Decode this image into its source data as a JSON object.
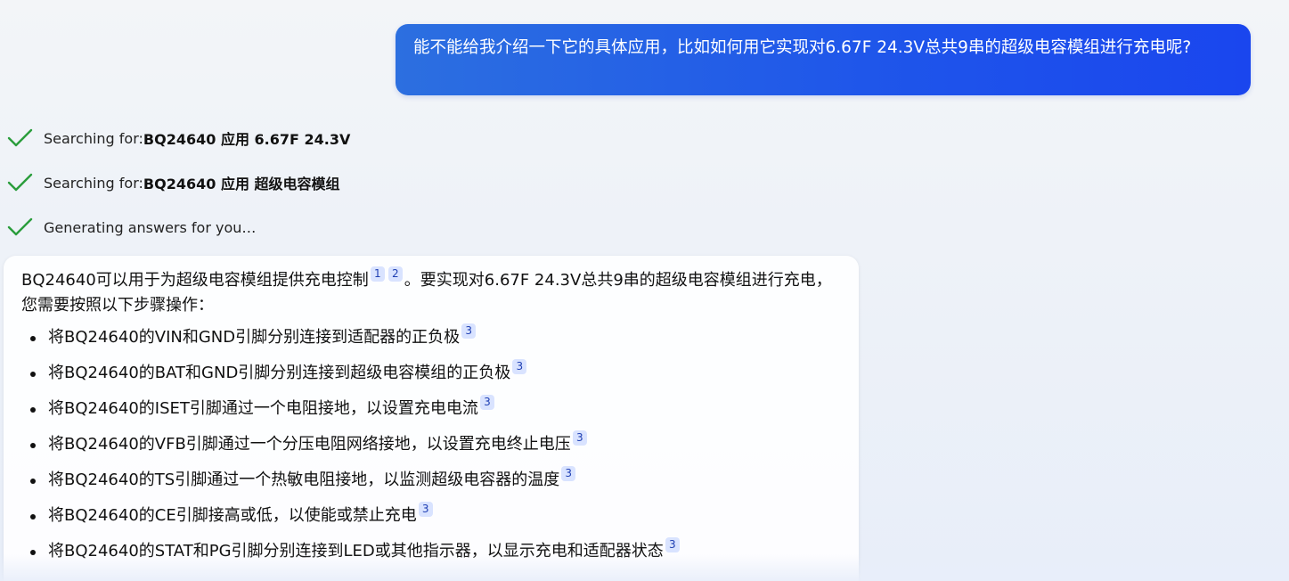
{
  "user_message": {
    "text": "能不能给我介绍一下它的具体应用，比如如何用它实现对6.67F 24.3V总共9串的超级电容模组进行充电呢?"
  },
  "status": [
    {
      "prefix": "Searching for: ",
      "query": "BQ24640 应用 6.67F 24.3V"
    },
    {
      "prefix": "Searching for: ",
      "query": "BQ24640 应用 超级电容模组"
    },
    {
      "prefix": "Generating answers for you…",
      "query": ""
    }
  ],
  "answer": {
    "intro_part1": "BQ24640可以用于为超级电容模组提供充电控制",
    "intro_cites": [
      "1",
      "2"
    ],
    "intro_part2": "。要实现对6.67F 24.3V总共9串的超级电容模组进行充电，您需要按照以下步骤操作：",
    "steps": [
      {
        "text": "将BQ24640的VIN和GND引脚分别连接到适配器的正负极",
        "cite": "3"
      },
      {
        "text": "将BQ24640的BAT和GND引脚分别连接到超级电容模组的正负极",
        "cite": "3"
      },
      {
        "text": "将BQ24640的ISET引脚通过一个电阻接地，以设置充电电流",
        "cite": "3"
      },
      {
        "text": "将BQ24640的VFB引脚通过一个分压电阻网络接地，以设置充电终止电压",
        "cite": "3"
      },
      {
        "text": "将BQ24640的TS引脚通过一个热敏电阻接地，以监测超级电容器的温度",
        "cite": "3"
      },
      {
        "text": "将BQ24640的CE引脚接高或低，以使能或禁止充电",
        "cite": "3"
      },
      {
        "text": "将BQ24640的STAT和PG引脚分别连接到LED或其他指示器，以显示充电和适配器状态",
        "cite": "3"
      }
    ]
  },
  "colors": {
    "user_bubble": "#1f56ea",
    "check": "#2a9d3c",
    "cite_bg": "#d9e3ff"
  }
}
